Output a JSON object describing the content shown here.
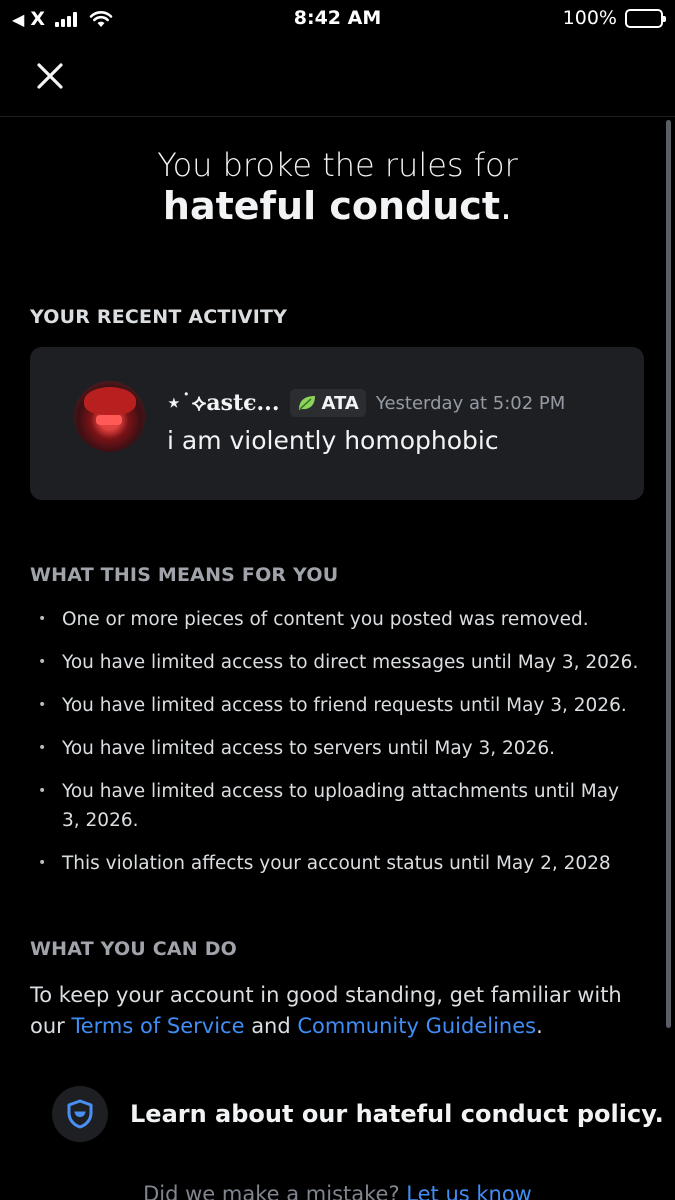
{
  "status_bar": {
    "back_glyph": "◀",
    "carrier": "X",
    "time": "8:42 AM",
    "battery": "100%",
    "battery_level": 1.0
  },
  "title": {
    "line1": "You broke the rules for",
    "emphasis": "hateful conduct",
    "suffix": "."
  },
  "recent_activity": {
    "label": "YOUR RECENT ACTIVITY",
    "message": {
      "username": "⋆˙⟡astє...",
      "tag": "ATA",
      "tag_icon": "leaf-icon",
      "timestamp": "Yesterday at 5:02 PM",
      "text": "i am violently homophobic"
    }
  },
  "means": {
    "label": "WHAT THIS MEANS FOR YOU",
    "items": [
      "One or more pieces of content you posted was removed.",
      "You have limited access to direct messages until May 3, 2026.",
      "You have limited access to friend requests until May 3, 2026.",
      "You have limited access to servers until May 3, 2026.",
      "You have limited access to uploading attachments until May 3, 2026.",
      "This violation affects your account status until May 2, 2028"
    ]
  },
  "can_do": {
    "label": "WHAT YOU CAN DO",
    "text_before": "To keep your account in good standing, get familiar with our ",
    "link1": "Terms of Service",
    "text_middle": " and ",
    "link2": "Community Guidelines",
    "text_after": "."
  },
  "policy": {
    "icon": "shield-icon",
    "label": "Learn about our hateful conduct policy."
  },
  "mistake": {
    "text": "Did we make a mistake? ",
    "link": "Let us know"
  },
  "colors": {
    "background": "#000000",
    "card": "#1e1f22",
    "link": "#3f8ef6",
    "muted_label": "#a0a3aa"
  }
}
